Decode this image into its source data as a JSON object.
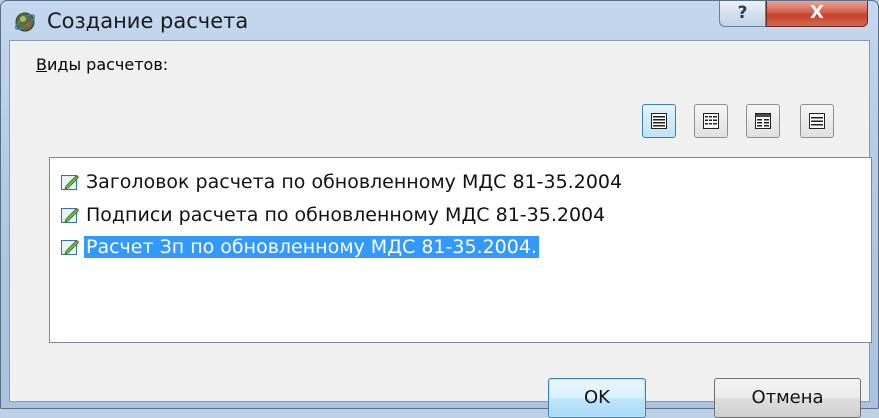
{
  "window": {
    "title": "Создание расчета",
    "help_glyph": "?",
    "close_glyph": "X"
  },
  "section": {
    "label_accel": "В",
    "label_rest": "иды расчетов:"
  },
  "view_buttons": [
    {
      "name": "details-view",
      "icon": "details-view-icon",
      "active": true
    },
    {
      "name": "small-icons-view",
      "icon": "small-icons-view-icon",
      "active": false
    },
    {
      "name": "list-view",
      "icon": "list-view-icon",
      "active": false
    },
    {
      "name": "large-view",
      "icon": "large-view-icon",
      "active": false
    }
  ],
  "calc_types": [
    {
      "label": "Заголовок расчета по обновленному МДС 81-35.2004",
      "icon": "edit-doc-icon",
      "selected": false
    },
    {
      "label": "Подписи расчета по обновленному МДС 81-35.2004",
      "icon": "edit-doc-icon",
      "selected": false
    },
    {
      "label": "Расчет Зп по обновленному МДС 81-35.2004.",
      "icon": "edit-doc-icon",
      "selected": true
    }
  ],
  "buttons": {
    "ok": "OK",
    "cancel": "Отмена"
  },
  "colors": {
    "selection": "#3399ff",
    "close_button": "#c5402a",
    "title_gradient": "#b0c8e4"
  }
}
